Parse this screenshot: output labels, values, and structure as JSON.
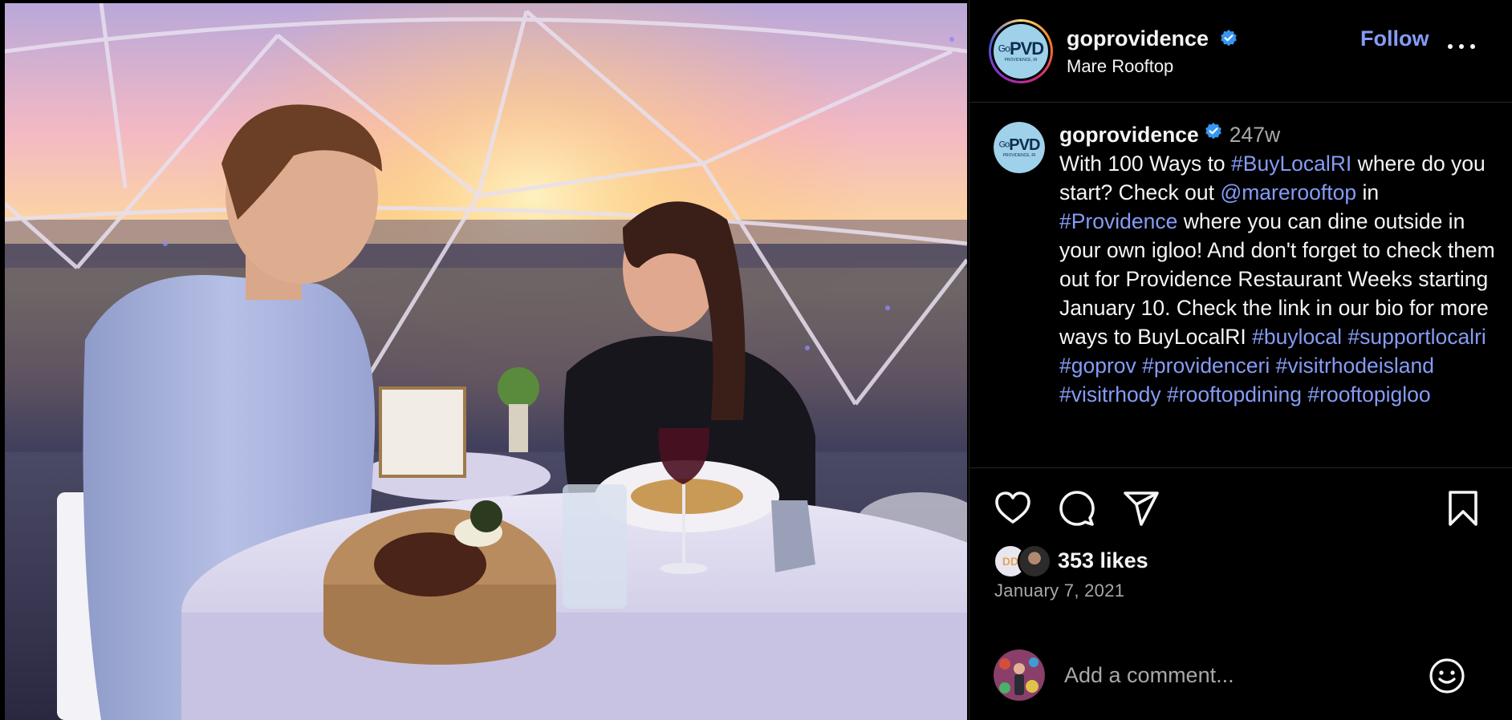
{
  "header": {
    "username": "goprovidence",
    "location": "Mare Rooftop",
    "follow_label": "Follow",
    "more_icon": "more-horizontal-icon",
    "verified_icon": "verified-badge-icon"
  },
  "avatar": {
    "logo_go": "Go",
    "logo_main": "PVD",
    "logo_sub": "PROVIDENCE, RI"
  },
  "caption": {
    "username": "goprovidence",
    "time": "247w",
    "segments": [
      {
        "t": "text",
        "v": "With 100 Ways to "
      },
      {
        "t": "link",
        "v": "#BuyLocalRI"
      },
      {
        "t": "text",
        "v": " where do you start? Check out "
      },
      {
        "t": "link",
        "v": "@marerooftop"
      },
      {
        "t": "text",
        "v": " in "
      },
      {
        "t": "link",
        "v": "#Providence"
      },
      {
        "t": "text",
        "v": " where you can dine outside in your own igloo! And don't forget to check them out for Providence Restaurant Weeks starting January 10. Check the link in our bio for more ways to BuyLocalRI "
      },
      {
        "t": "link",
        "v": "#buylocal"
      },
      {
        "t": "text",
        "v": " "
      },
      {
        "t": "link",
        "v": "#supportlocalri"
      },
      {
        "t": "text",
        "v": " "
      },
      {
        "t": "link",
        "v": "#goprov"
      },
      {
        "t": "text",
        "v": " "
      },
      {
        "t": "link",
        "v": "#providenceri"
      },
      {
        "t": "text",
        "v": " "
      },
      {
        "t": "link",
        "v": "#visitrhodeisland"
      },
      {
        "t": "text",
        "v": " "
      },
      {
        "t": "link",
        "v": "#visitrhody"
      },
      {
        "t": "text",
        "v": " "
      },
      {
        "t": "link",
        "v": "#rooftopdining"
      },
      {
        "t": "text",
        "v": " "
      },
      {
        "t": "link",
        "v": "#rooftopigloo"
      }
    ]
  },
  "actions": {
    "like_icon": "heart-icon",
    "comment_icon": "comment-bubble-icon",
    "share_icon": "paper-plane-icon",
    "save_icon": "bookmark-icon"
  },
  "likes": {
    "text": "353 likes",
    "liker1_initials": "DD"
  },
  "date": "January 7, 2021",
  "comment": {
    "placeholder": "Add a comment...",
    "emoji_icon": "smiley-icon"
  },
  "colors": {
    "link": "#859cf5",
    "verified": "#3797f0",
    "muted": "#a8a8a8",
    "background": "#000000"
  }
}
